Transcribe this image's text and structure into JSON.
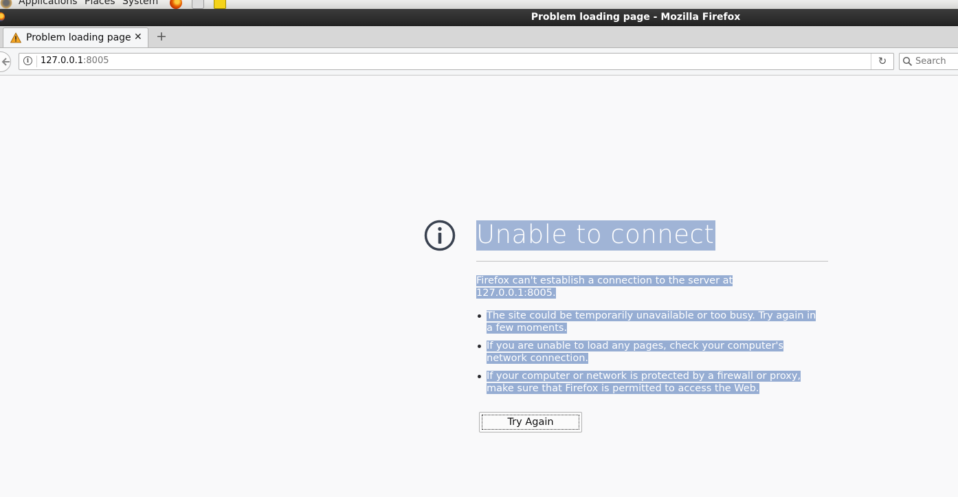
{
  "system_panel": {
    "menus": [
      "Applications",
      "Places",
      "System"
    ]
  },
  "window": {
    "title": "Problem loading page - Mozilla Firefox"
  },
  "tabs": [
    {
      "label": "Problem loading page",
      "icon": "warning-icon",
      "active": true
    }
  ],
  "navbar": {
    "url_host": "127.0.0.1",
    "url_port": ":8005",
    "search_placeholder": "Search"
  },
  "error_page": {
    "title": "Unable to connect",
    "description_line1": "Firefox can't establish a connection to the server at",
    "description_line2": "127.0.0.1:8005.",
    "suggestions": [
      "The site could be temporarily unavailable or too busy. Try again in a few moments.",
      "If you are unable to load any pages, check your computer's network connection.",
      "If your computer or network is protected by a firewall or proxy, make sure that Firefox is permitted to access the Web."
    ],
    "try_again_label": "Try Again"
  },
  "colors": {
    "selection": "#96add3",
    "page_background": "#f9f9fa",
    "icon": "#3a4250"
  }
}
